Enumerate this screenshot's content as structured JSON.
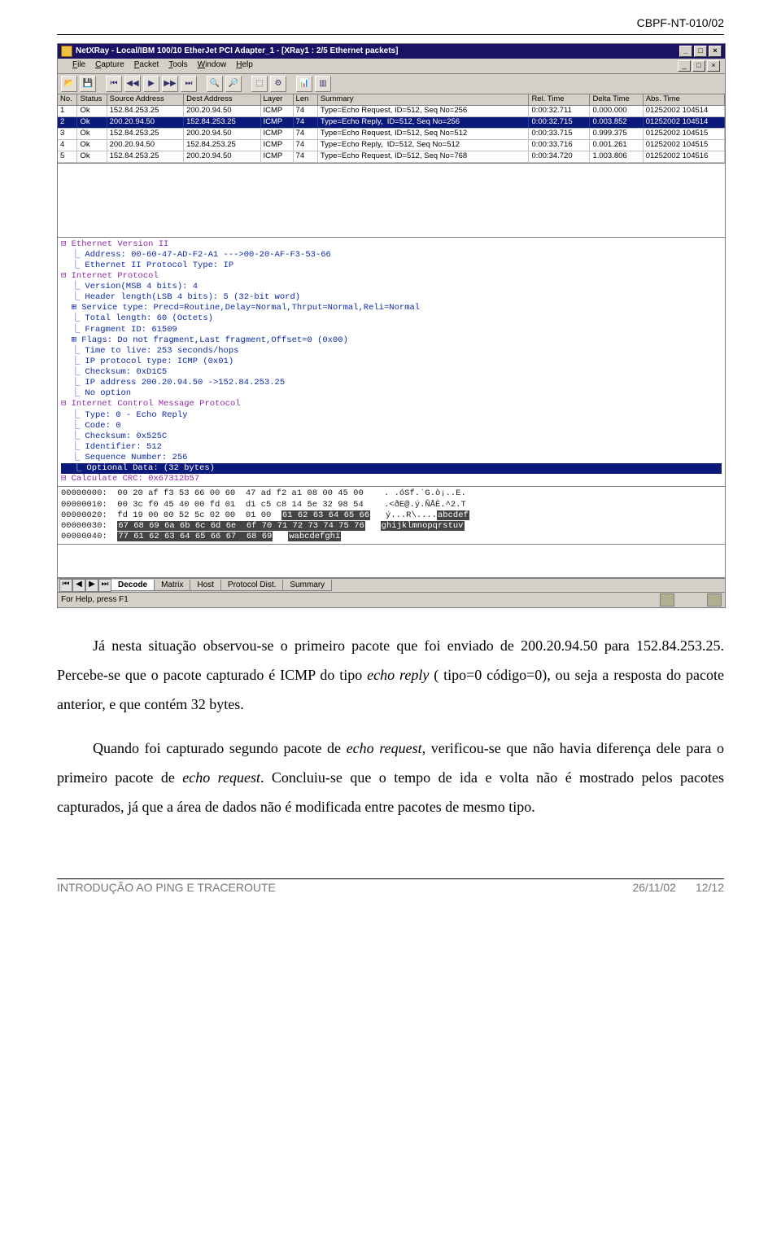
{
  "header_id": "CBPF-NT-010/02",
  "window": {
    "title": "NetXRay - Local/IBM 100/10 EtherJet PCI Adapter_1 - [XRay1 : 2/5 Ethernet packets]",
    "subtitle": "",
    "sys_buttons": {
      "min": "_",
      "max": "□",
      "close": "×"
    },
    "menus": {
      "file": "File",
      "capture": "Capture",
      "packet": "Packet",
      "tools": "Tools",
      "window": "Window",
      "help": "Help"
    }
  },
  "toolbar_icons": [
    "open-icon",
    "save-icon",
    "|",
    "first-icon",
    "prev-icon",
    "play-icon",
    "next-icon",
    "last-icon",
    "|",
    "find-icon",
    "zoom-icon",
    "|",
    "raw-icon",
    "options-icon",
    "|",
    "chart-icon",
    "filter-icon"
  ],
  "grid": {
    "columns": {
      "no": "No.",
      "status": "Status",
      "src": "Source Address",
      "dst": "Dest Address",
      "layer": "Layer",
      "len": "Len",
      "summary": "Summary",
      "reltime": "Rel. Time",
      "deltatime": "Delta Time",
      "abstime": "Abs. Time"
    },
    "rows": [
      {
        "no": "1",
        "status": "Ok",
        "src": "152.84.253.25",
        "dst": "200.20.94.50",
        "layer": "ICMP",
        "len": "74",
        "summary": "Type=Echo Request, ID=512, Seq No=256",
        "reltime": "0:00:32.711",
        "deltatime": "0.000.000",
        "abstime": "01252002 104514"
      },
      {
        "no": "2",
        "status": "Ok",
        "src": "200.20.94.50",
        "dst": "152.84.253.25",
        "layer": "ICMP",
        "len": "74",
        "summary": "Type=Echo Reply,  ID=512, Seq No=256",
        "reltime": "0:00:32.715",
        "deltatime": "0.003.852",
        "abstime": "01252002 104514"
      },
      {
        "no": "3",
        "status": "Ok",
        "src": "152.84.253.25",
        "dst": "200.20.94.50",
        "layer": "ICMP",
        "len": "74",
        "summary": "Type=Echo Request, ID=512, Seq No=512",
        "reltime": "0:00:33.715",
        "deltatime": "0.999.375",
        "abstime": "01252002 104515"
      },
      {
        "no": "4",
        "status": "Ok",
        "src": "200.20.94.50",
        "dst": "152.84.253.25",
        "layer": "ICMP",
        "len": "74",
        "summary": "Type=Echo Reply,  ID=512, Seq No=512",
        "reltime": "0:00:33.716",
        "deltatime": "0.001.261",
        "abstime": "01252002 104515"
      },
      {
        "no": "5",
        "status": "Ok",
        "src": "152.84.253.25",
        "dst": "200.20.94.50",
        "layer": "ICMP",
        "len": "74",
        "summary": "Type=Echo Request, ID=512, Seq No=768",
        "reltime": "0:00:34.720",
        "deltatime": "1.003.806",
        "abstime": "01252002 104516"
      }
    ],
    "selected_index": 1
  },
  "tree": [
    {
      "t": "⊟ Ethernet Version II",
      "cls": "hdr"
    },
    {
      "t": "  ⎿ Address: 00-60-47-AD-F2-A1 --->00-20-AF-F3-53-66"
    },
    {
      "t": "  ⎿ Ethernet II Protocol Type: IP"
    },
    {
      "t": "⊟ Internet Protocol",
      "cls": "hdr"
    },
    {
      "t": "  ⎿ Version(MSB 4 bits): 4"
    },
    {
      "t": "  ⎿ Header length(LSB 4 bits): 5 (32-bit word)"
    },
    {
      "t": "  ⊞ Service type: Precd=Routine,Delay=Normal,Thrput=Normal,Reli=Normal"
    },
    {
      "t": "  ⎿ Total length: 60 (Octets)"
    },
    {
      "t": "  ⎿ Fragment ID: 61509"
    },
    {
      "t": "  ⊞ Flags: Do not fragment,Last fragment,Offset=0 (0x00)"
    },
    {
      "t": "  ⎿ Time to live: 253 seconds/hops"
    },
    {
      "t": "  ⎿ IP protocol type: ICMP (0x01)"
    },
    {
      "t": "  ⎿ Checksum: 0xD1C5"
    },
    {
      "t": "  ⎿ IP address 200.20.94.50 ->152.84.253.25"
    },
    {
      "t": "  ⎿ No option"
    },
    {
      "t": "⊟ Internet Control Message Protocol",
      "cls": "hdr"
    },
    {
      "t": "  ⎿ Type: 0 - Echo Reply"
    },
    {
      "t": "  ⎿ Code: 0"
    },
    {
      "t": "  ⎿ Checksum: 0x525C"
    },
    {
      "t": "  ⎿ Identifier: 512"
    },
    {
      "t": "  ⎿ Sequence Number: 256"
    },
    {
      "t": "  ⎿ Optional Data: (32 bytes)",
      "cls": "sel"
    },
    {
      "t": "⊟ Calculate CRC: 0x67312b57",
      "cls": "hdr"
    }
  ],
  "hex": [
    {
      "off": "00000000:",
      "b": "00 20 af f3 53 66 00 60  47 ad f2 a1 08 00 45 00",
      "a": ". .óSf.`G.ò¡..E."
    },
    {
      "off": "00000010:",
      "b": "00 3c f0 45 40 00 fd 01  d1 c5 c8 14 5e 32 98 54",
      "a": ".<ðE@.ý.ÑÅÈ.^2.T"
    },
    {
      "off": "00000020:",
      "b": "fd 19 00 00 52 5c 02 00  01 00 ",
      "hl": "61 62 63 64 65 66",
      "a": "ý...R\\....",
      "ahl": "abcdef"
    },
    {
      "off": "00000030:",
      "bhl": "67 68 69 6a 6b 6c 6d 6e  6f 70 71 72 73 74 75 76",
      "ahl": "ghijklmnopqrstuv"
    },
    {
      "off": "00000040:",
      "bhl": "77 61 62 63 64 65 66 67  68 69",
      "ahl": "wabcdefghi"
    }
  ],
  "tabs": {
    "t1": "Decode",
    "t2": "Matrix",
    "t3": "Host",
    "t4": "Protocol Dist.",
    "t5": "Summary"
  },
  "statusbar": {
    "text": "For Help, press F1"
  },
  "paragraphs": {
    "p1_a": "Já nesta situação observou-se o primeiro pacote que foi enviado de 200.20.94.50 para 152.84.253.25. Percebe-se que o pacote capturado é ICMP do tipo ",
    "p1_i1": "echo reply",
    "p1_b": " ( tipo=0 código=0), ou seja a resposta do pacote anterior, e que contém 32 bytes.",
    "p2_a": "Quando foi capturado segundo pacote de ",
    "p2_i1": "echo request",
    "p2_b": ", verificou-se que não havia diferença dele para o primeiro pacote de ",
    "p2_i2": "echo request",
    "p2_c": ". Concluiu-se que o tempo de ida e volta não é mostrado pelos pacotes capturados, já que a área de dados não é modificada entre pacotes de mesmo tipo."
  },
  "footer": {
    "left": "INTRODUÇÃO AO PING E TRACEROUTE",
    "date": "26/11/02",
    "page": "12/12"
  }
}
